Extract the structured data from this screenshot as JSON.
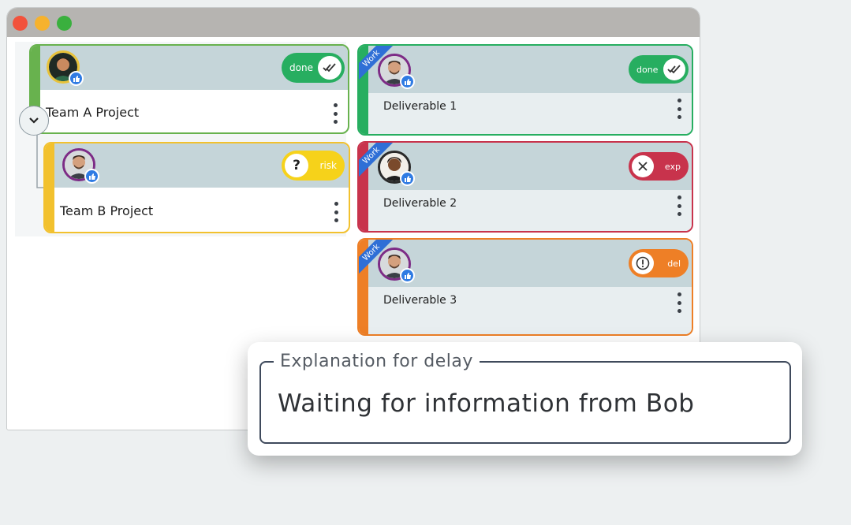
{
  "window": {
    "title": ""
  },
  "teams": [
    {
      "title": "Team A Project",
      "status": "done",
      "accent": "#68b24e",
      "status_color": "#27ae60"
    },
    {
      "title": "Team B Project",
      "status": "risk",
      "accent": "#f2c12e",
      "status_color": "#f6d21a"
    }
  ],
  "deliverables": [
    {
      "ribbon": "Work",
      "title": "Deliverable 1",
      "status": "done",
      "accent": "#27ae60",
      "status_color": "#27ae60",
      "status_icon": "double-check-icon"
    },
    {
      "ribbon": "Work",
      "title": "Deliverable 2",
      "status": "exp",
      "accent": "#c8334c",
      "status_color": "#c8334c",
      "status_icon": "x-icon"
    },
    {
      "ribbon": "Work",
      "title": "Deliverable 3",
      "status": "del",
      "accent": "#ee7f26",
      "status_color": "#ee7f26",
      "status_icon": "exclamation-icon"
    }
  ],
  "explanation": {
    "label": "Explanation for delay",
    "value": "Waiting for information from Bob"
  }
}
